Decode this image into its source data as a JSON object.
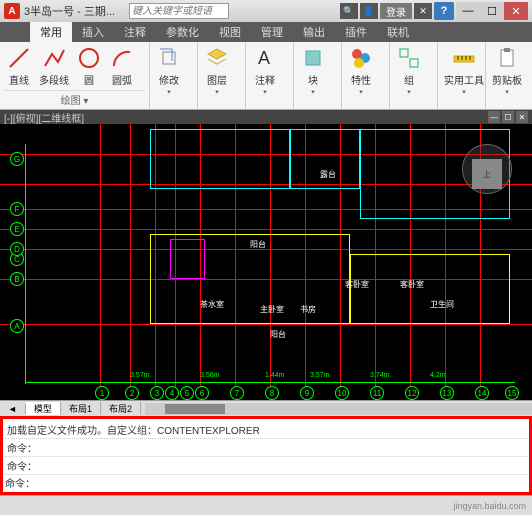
{
  "titlebar": {
    "filename": "3半岛一号 - 三期...",
    "search_placeholder": "键入关键字或短语",
    "login": "登录"
  },
  "tabs": [
    "常用",
    "插入",
    "注释",
    "参数化",
    "视图",
    "管理",
    "输出",
    "插件",
    "联机"
  ],
  "active_tab": 0,
  "ribbon": {
    "draw_panel": "绘图 ▾",
    "line": "直线",
    "polyline": "多段线",
    "circle": "圆",
    "arc": "圆弧",
    "modify": "修改",
    "layers": "图层",
    "annotate": "注释",
    "block": "块",
    "properties": "特性",
    "group": "组",
    "utilities": "实用工具",
    "clipboard": "剪贴板"
  },
  "drawing": {
    "title": "[-][俯视][二维线框]",
    "axis_letters": [
      "A",
      "B",
      "C",
      "D",
      "E",
      "F",
      "G"
    ],
    "axis_numbers": [
      "1",
      "2",
      "3",
      "4",
      "5",
      "6",
      "7",
      "8",
      "9",
      "10",
      "11",
      "12",
      "13",
      "14",
      "15"
    ],
    "rooms": {
      "balcony": "阳台",
      "balcony2": "阳台",
      "tea": "茶水室",
      "master": "主卧室",
      "study": "书房",
      "guest": "客卧室",
      "guest2": "客卧室",
      "bath": "卫生间",
      "terrace": "露台"
    },
    "dims": [
      "3.57m",
      "3.56m",
      "1.44m",
      "3.57m",
      "3.74m",
      "4.2m"
    ],
    "viewcube": "上"
  },
  "layout": {
    "tabs": [
      "模型",
      "布局1",
      "布局2"
    ],
    "active": 0
  },
  "command": {
    "line1": "加载自定义文件成功。自定义组：CONTENTEXPLORER",
    "prompt": "命令：",
    "line2": "命令：",
    "line3": "命令："
  },
  "statusbar": {
    "watermark": "jingyan.baidu.com"
  }
}
